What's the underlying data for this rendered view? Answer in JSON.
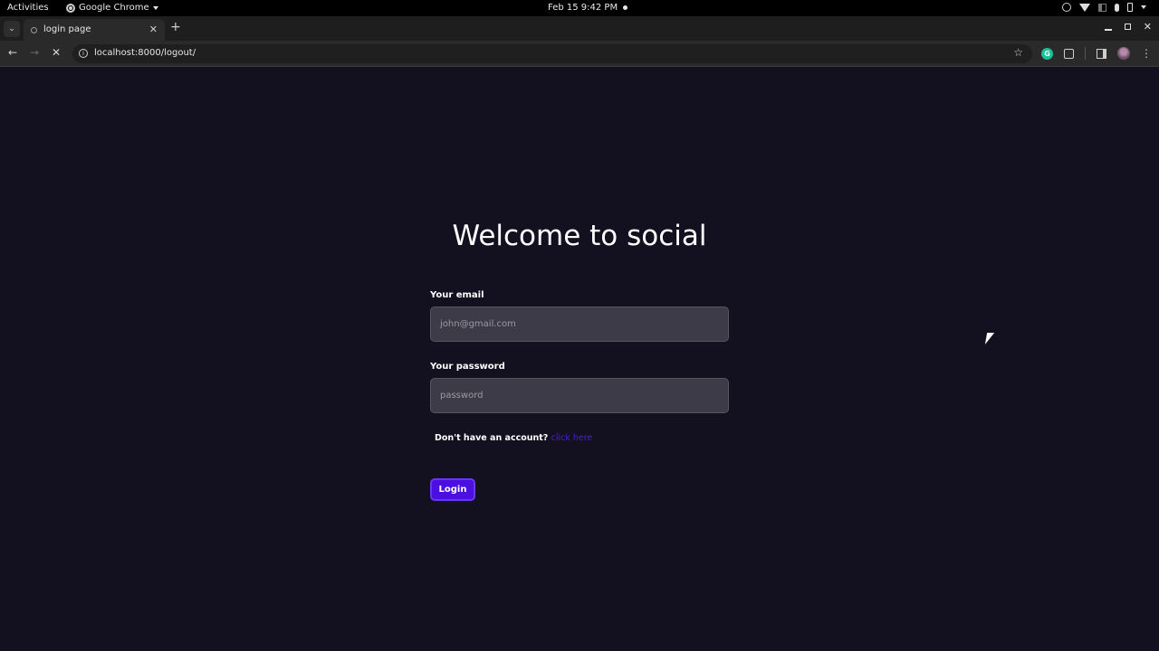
{
  "system_bar": {
    "activities": "Activities",
    "app_name": "Google Chrome",
    "clock": "Feb 15  9:42 PM"
  },
  "browser": {
    "tab": {
      "title": "login page"
    },
    "url": "localhost:8000/logout/"
  },
  "login": {
    "heading": "Welcome to social",
    "email_label": "Your email",
    "email_placeholder": "john@gmail.com",
    "email_value": "",
    "password_label": "Your password",
    "password_placeholder": "password",
    "password_value": "",
    "signup_prompt": "Don't have an account?",
    "signup_link": "click here",
    "submit_label": "Login"
  },
  "colors": {
    "page_bg": "#13111f",
    "input_bg": "#3c3b47",
    "accent": "#4b0fe0",
    "link": "#4a1fd6"
  }
}
